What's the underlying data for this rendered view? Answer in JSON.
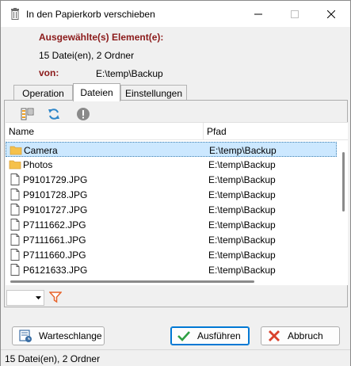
{
  "window": {
    "title": "In den Papierkorb verschieben",
    "icon": "trash-bin-icon"
  },
  "header": {
    "selected_label": "Ausgewählte(s) Element(e):",
    "selected_summary": "15 Datei(en), 2 Ordner",
    "from_label": "von:",
    "from_path": "E:\\temp\\Backup"
  },
  "tabs": [
    {
      "label": "Operation",
      "active": false
    },
    {
      "label": "Dateien",
      "active": true
    },
    {
      "label": "Einstellungen",
      "active": false
    }
  ],
  "list": {
    "columns": {
      "name": "Name",
      "path": "Pfad"
    },
    "rows": [
      {
        "name": "Camera",
        "path": "E:\\temp\\Backup",
        "type": "folder",
        "selected": true
      },
      {
        "name": "Photos",
        "path": "E:\\temp\\Backup",
        "type": "folder"
      },
      {
        "name": "P9101729.JPG",
        "path": "E:\\temp\\Backup",
        "type": "file"
      },
      {
        "name": "P9101728.JPG",
        "path": "E:\\temp\\Backup",
        "type": "file"
      },
      {
        "name": "P9101727.JPG",
        "path": "E:\\temp\\Backup",
        "type": "file"
      },
      {
        "name": "P7111662.JPG",
        "path": "E:\\temp\\Backup",
        "type": "file"
      },
      {
        "name": "P7111661.JPG",
        "path": "E:\\temp\\Backup",
        "type": "file"
      },
      {
        "name": "P7111660.JPG",
        "path": "E:\\temp\\Backup",
        "type": "file"
      },
      {
        "name": "P6121633.JPG",
        "path": "E:\\temp\\Backup",
        "type": "file"
      }
    ]
  },
  "buttons": {
    "queue": "Warteschlange",
    "execute": "Ausführen",
    "cancel": "Abbruch"
  },
  "status": "15 Datei(en), 2 Ordner",
  "colors": {
    "accent": "#0078d4",
    "label_red": "#8b1a1a",
    "selection": "#cce8ff",
    "folder": "#f5c14b"
  }
}
